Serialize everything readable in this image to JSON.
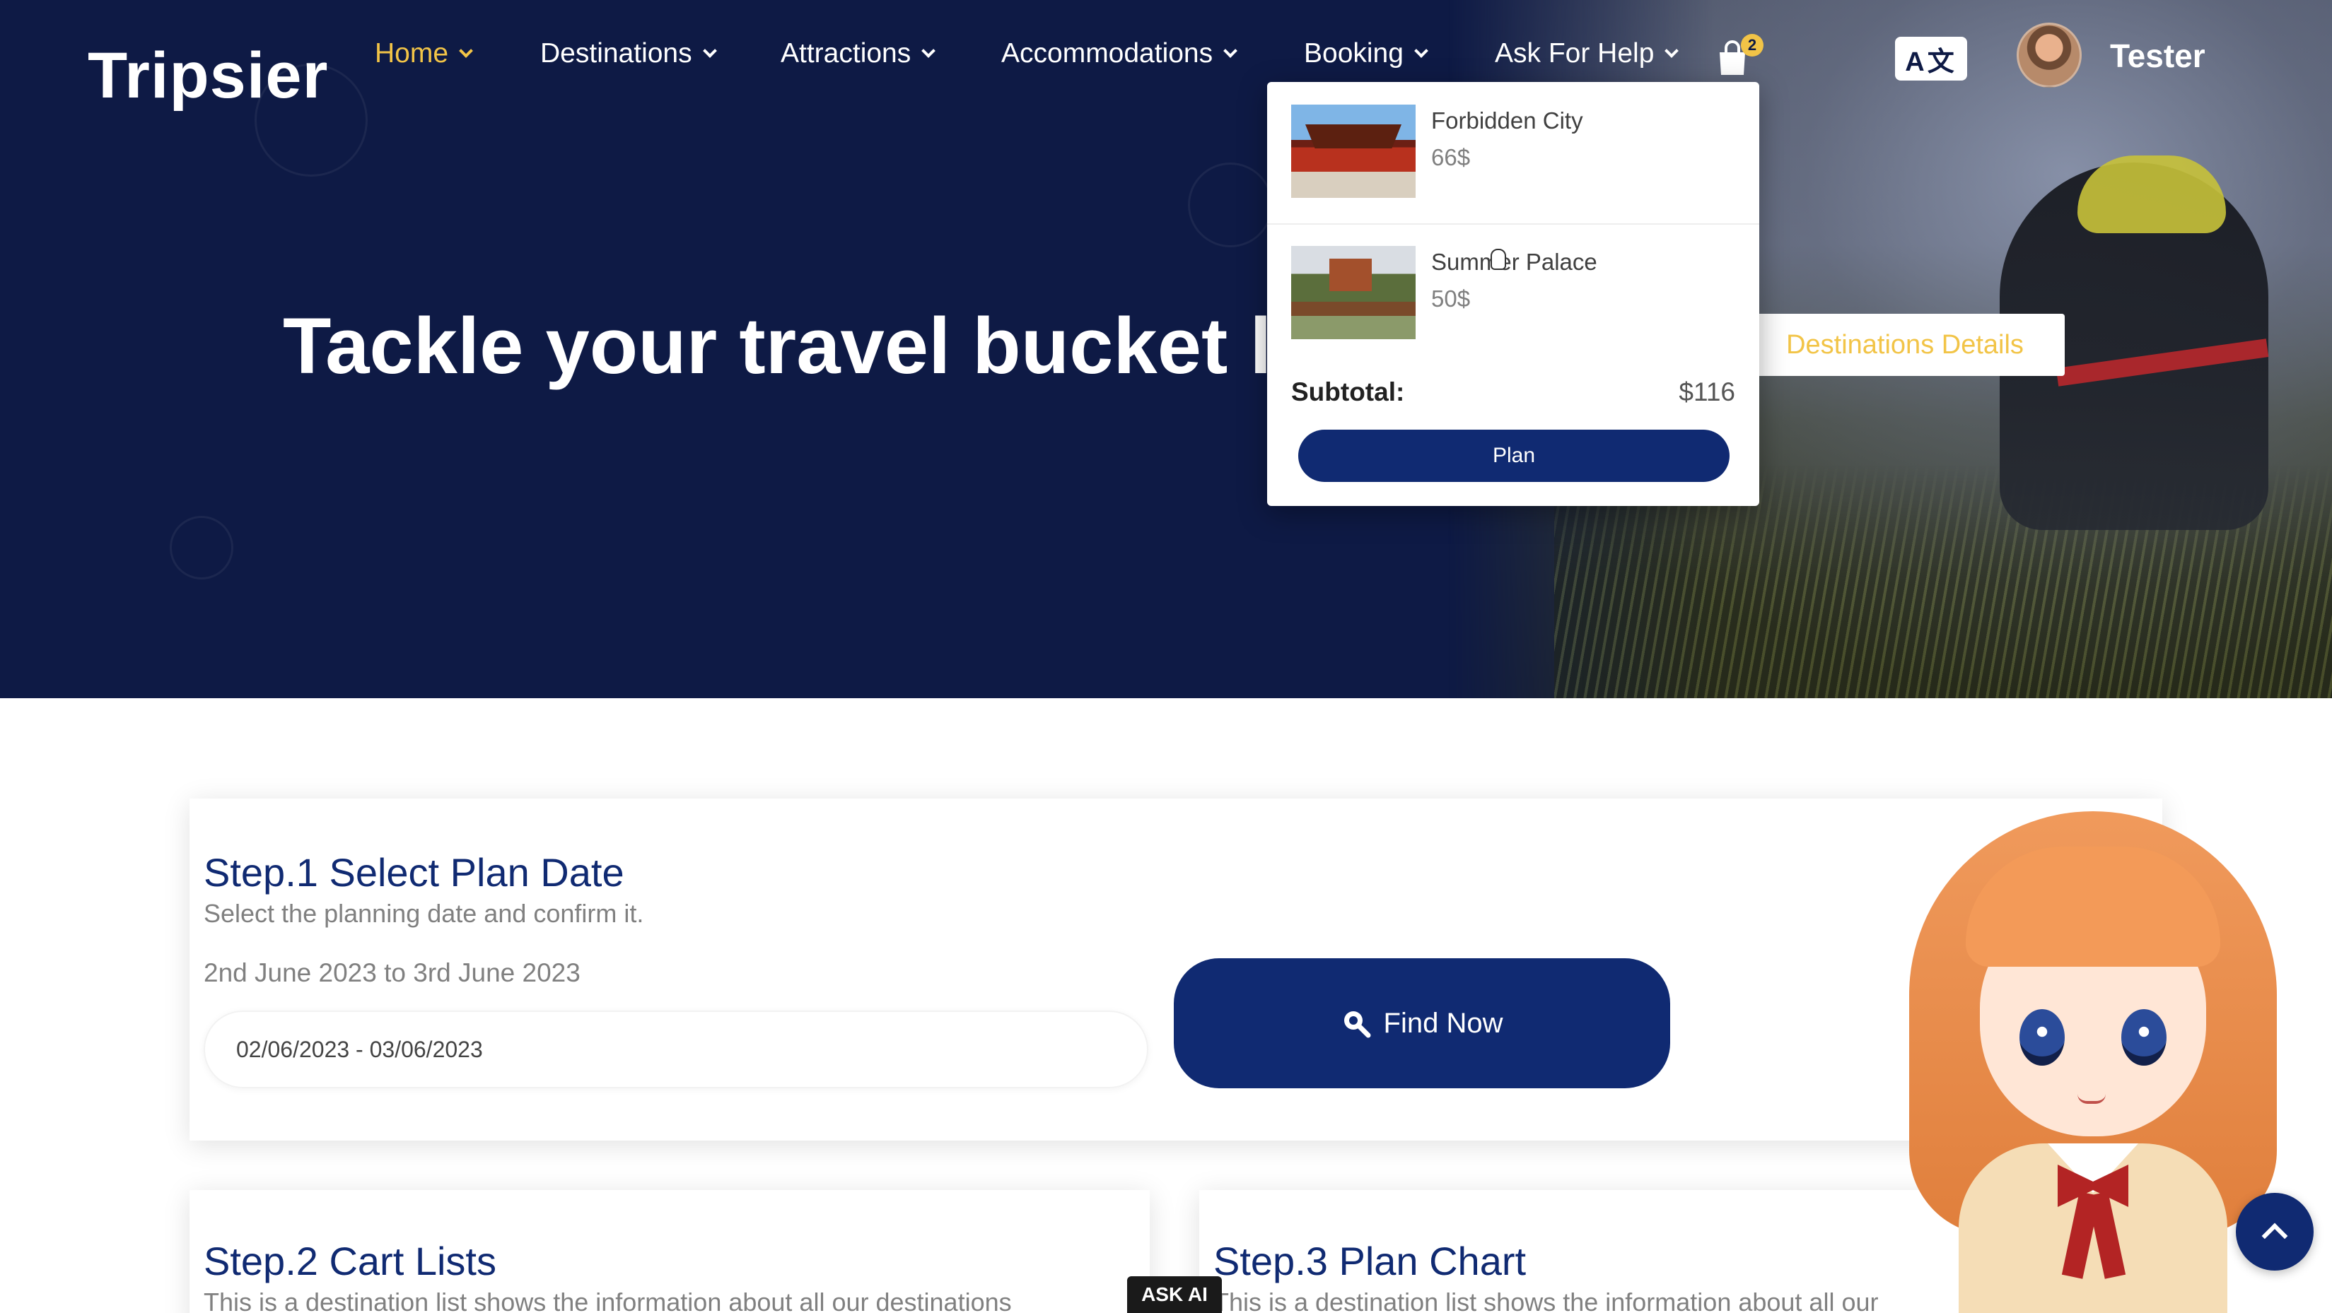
{
  "brand": {
    "logo_text": "Tripsier"
  },
  "nav": {
    "items": [
      {
        "label": "Home",
        "active": true
      },
      {
        "label": "Destinations",
        "active": false
      },
      {
        "label": "Attractions",
        "active": false
      },
      {
        "label": "Accommodations",
        "active": false
      },
      {
        "label": "Booking",
        "active": false
      },
      {
        "label": "Ask For Help",
        "active": false
      }
    ],
    "cart_count": "2",
    "language_icon_text": "A文",
    "user_name": "Tester"
  },
  "hero": {
    "title": "Tackle your travel bucket l",
    "details_button": "Destinations Details"
  },
  "cart": {
    "items": [
      {
        "name": "Forbidden City",
        "price": "66$"
      },
      {
        "name": "Summer Palace",
        "price": "50$"
      }
    ],
    "subtotal_label": "Subtotal:",
    "subtotal_value": "$116",
    "plan_button": "Plan"
  },
  "step1": {
    "title": "Step.1 Select Plan Date",
    "subtitle": "Select the planning date and confirm it.",
    "date_text": "2nd June 2023 to 3rd June 2023",
    "date_value": "02/06/2023 - 03/06/2023",
    "find_button": "Find Now"
  },
  "step2": {
    "title": "Step.2 Cart Lists",
    "subtitle": "This is a destination list shows the information about all our destinations"
  },
  "step3": {
    "title": "Step.3 Plan Chart",
    "subtitle": "This is a destination list shows the information about all our"
  },
  "ask_ai_label": "ASK AI",
  "colors": {
    "navy": "#0e1a45",
    "primary": "#102a72",
    "accent": "#f2c447"
  }
}
